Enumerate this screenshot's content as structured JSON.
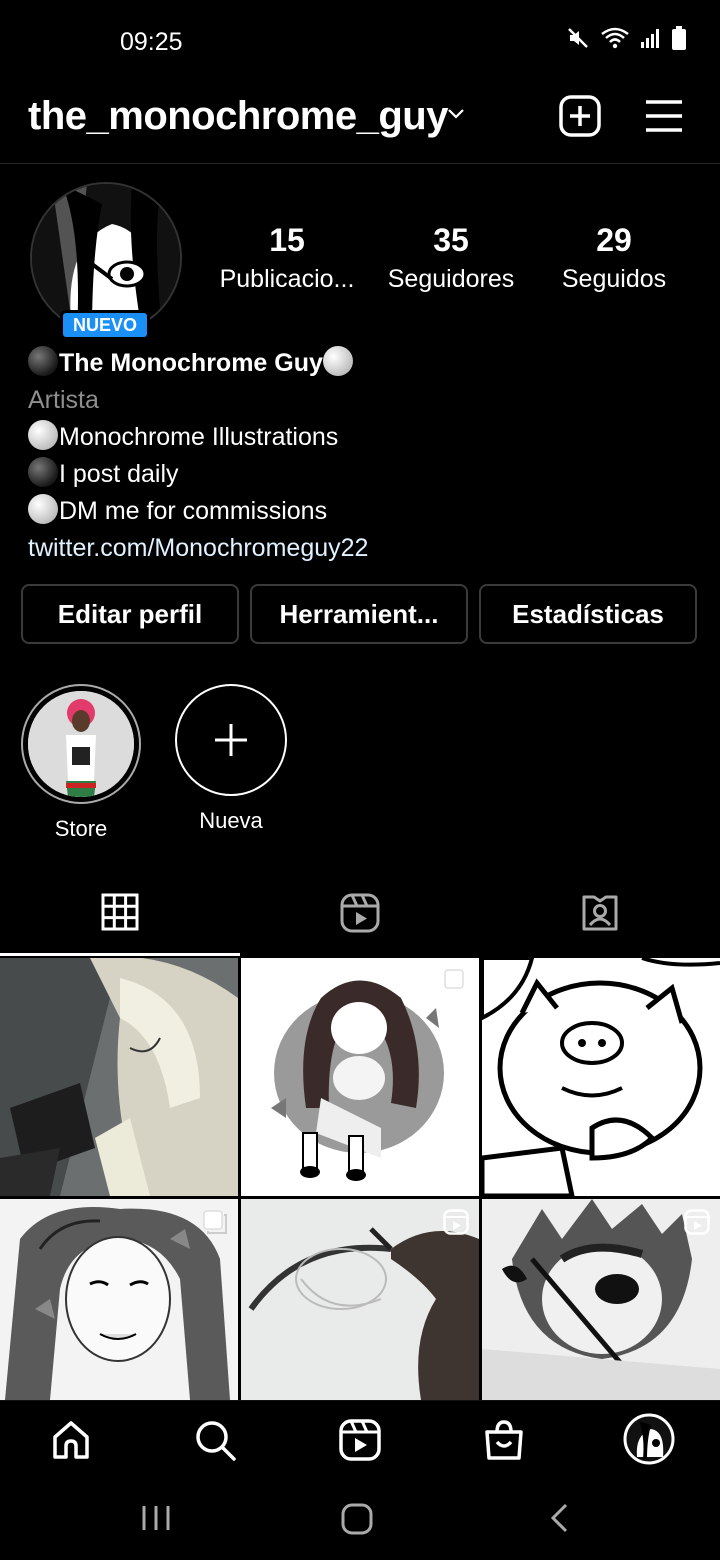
{
  "status": {
    "time": "09:25"
  },
  "header": {
    "username": "the_monochrome_guy"
  },
  "profile": {
    "badge": "NUEVO",
    "stats": [
      {
        "count": "15",
        "label": "Publicacio..."
      },
      {
        "count": "35",
        "label": "Seguidores"
      },
      {
        "count": "29",
        "label": "Seguidos"
      }
    ],
    "name": "The Monochrome Guy",
    "category": "Artista",
    "bio_lines": [
      "Monochrome Illustrations",
      "I post daily",
      "DM me for commissions"
    ],
    "link": "twitter.com/Monochromeguy22"
  },
  "actions": {
    "edit": "Editar perfil",
    "tools": "Herramient...",
    "stats": "Estadísticas"
  },
  "highlights": [
    {
      "label": "Store"
    },
    {
      "label": "Nueva"
    }
  ],
  "colors": {
    "accent": "#1a8ff5",
    "background": "#000000",
    "border": "#3a3a3a",
    "muted": "#8e8e8e"
  }
}
